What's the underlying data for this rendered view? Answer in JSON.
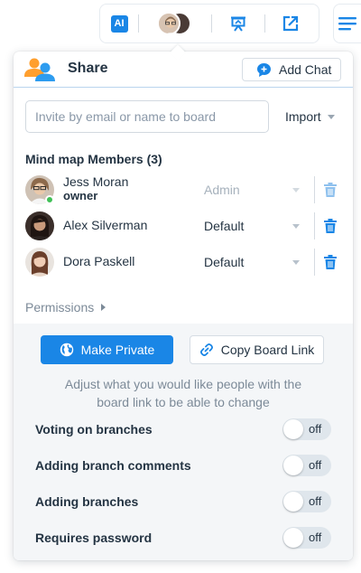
{
  "toolbar": {
    "ai_label": "AI"
  },
  "panel": {
    "title": "Share",
    "add_chat_label": "Add Chat",
    "invite_placeholder": "Invite by email or name to board",
    "import_label": "Import",
    "members_title": "Mind map Members (3)",
    "members": [
      {
        "name": "Jess Moran",
        "subtitle": "owner",
        "role": "Admin",
        "online": true,
        "role_disabled": true
      },
      {
        "name": "Alex Silverman",
        "role": "Default"
      },
      {
        "name": "Dora Paskell",
        "role": "Default"
      }
    ],
    "permissions_label": "Permissions"
  },
  "sharing": {
    "make_private_label": "Make Private",
    "copy_link_label": "Copy Board Link",
    "description": "Adjust what you would like people with the board link to be able to change",
    "options": [
      {
        "label": "Voting on branches",
        "state": "off"
      },
      {
        "label": "Adding branch comments",
        "state": "off"
      },
      {
        "label": "Adding branches",
        "state": "off"
      },
      {
        "label": "Requires password",
        "state": "off"
      }
    ]
  },
  "colors": {
    "accent": "#1a86e6",
    "online": "#40c057",
    "section_bg": "#f4f6f8"
  }
}
